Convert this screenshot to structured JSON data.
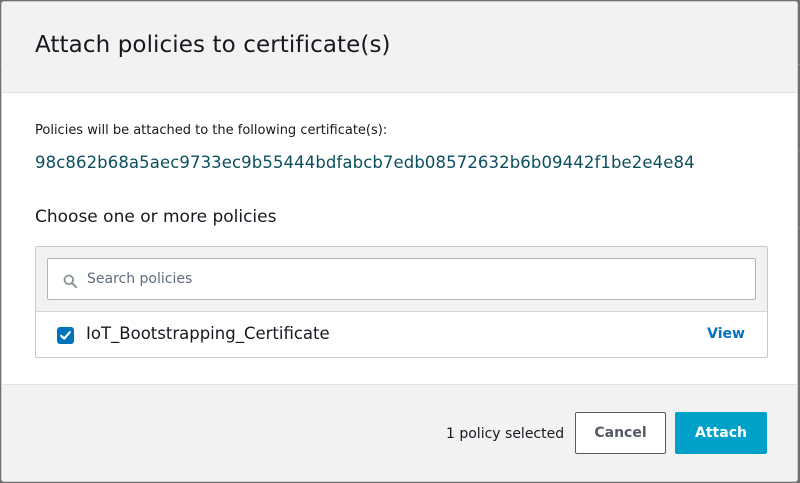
{
  "modal": {
    "title": "Attach policies to certificate(s)"
  },
  "certificates": {
    "intro": "Policies will be attached to the following certificate(s):",
    "ids": [
      "98c862b68a5aec9733ec9b55444bdfabcb7edb08572632b6b09442f1be2e4e84"
    ]
  },
  "policies": {
    "label": "Choose one or more policies",
    "search": {
      "placeholder": "Search policies",
      "value": ""
    },
    "items": [
      {
        "name": "IoT_Bootstrapping_Certificate",
        "checked": true,
        "view_label": "View"
      }
    ]
  },
  "footer": {
    "selected_text": "1 policy selected",
    "cancel_label": "Cancel",
    "attach_label": "Attach"
  },
  "colors": {
    "accent": "#00a1c9",
    "checkbox": "#0073bb",
    "link": "#0073bb",
    "cert_text": "#0b4f5f"
  },
  "icons": {
    "search": "search-icon",
    "check": "checkmark-icon"
  }
}
